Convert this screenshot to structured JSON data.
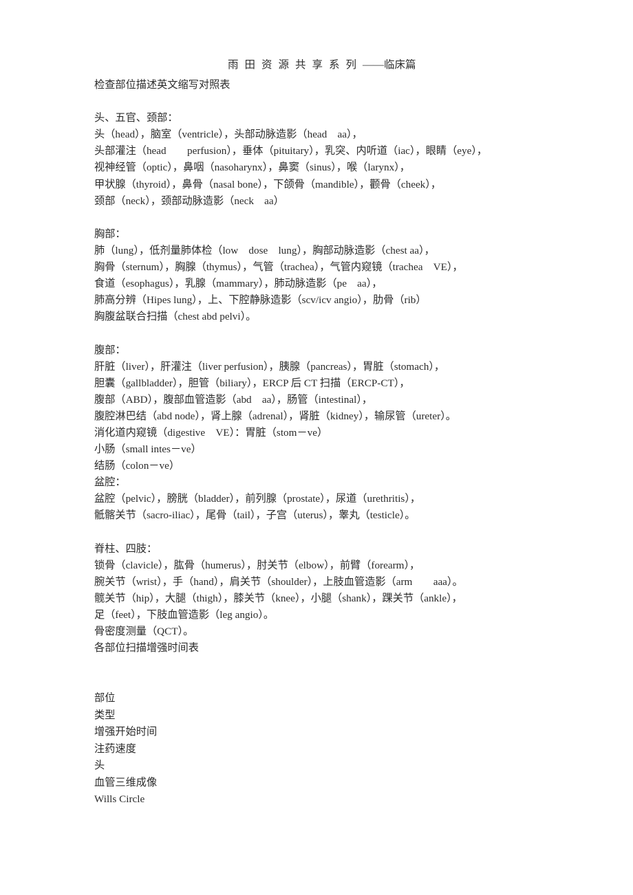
{
  "page": {
    "background_color": "#ffffff",
    "text_color": "#2b2b2b"
  },
  "header": {
    "spaced_text": "雨田资源共享系列",
    "tail_text": "——临床篇"
  },
  "document": {
    "title": "检查部位描述英文缩写对照表",
    "sections": [
      {
        "heading": "头、五官、颈部：",
        "lines": [
          "头（head），脑室（ventricle），头部动脉造影（head　aa），",
          "头部灌注（head　　perfusion），垂体（pituitary），乳突、内听道（iac），眼睛（eye），",
          "视神经管（optic），鼻咽（nasoharynx），鼻窦（sinus），喉（larynx），",
          "甲状腺（thyroid），鼻骨（nasal bone），下颌骨（mandible），颧骨（cheek），",
          "颈部（neck），颈部动脉造影（neck　aa）"
        ]
      },
      {
        "heading": "胸部：",
        "lines": [
          "肺（lung），低剂量肺体检（low　dose　lung），胸部动脉造影（chest aa），",
          "胸骨（sternum），胸腺（thymus），气管（trachea），气管内窥镜（trachea　VE），",
          "食道（esophagus），乳腺（mammary），肺动脉造影（pe　aa），",
          "肺高分辨（Hipes lung），上、下腔静脉造影（scv/icv angio），肋骨（rib）",
          "胸腹盆联合扫描（chest abd pelvi）。"
        ]
      },
      {
        "heading": "腹部：",
        "lines": [
          "肝脏（liver），肝灌注（liver perfusion），胰腺（pancreas），胃脏（stomach），",
          "胆囊（gallbladder），胆管（biliary），ERCP 后 CT 扫描（ERCP-CT），",
          "腹部（ABD），腹部血管造影（abd　aa），肠管（intestinal），",
          "腹腔淋巴结（abd node），肾上腺（adrenal），肾脏（kidney），输尿管（ureter）。",
          "消化道内窥镜（digestive　VE）：胃脏（stom－ve）",
          "小肠（small intes－ve）",
          "结肠（colon－ve）"
        ]
      },
      {
        "heading": "盆腔：",
        "lines": [
          "盆腔（pelvic），膀胱（bladder），前列腺（prostate），尿道（urethritis），",
          "骶髂关节（sacro-iliac），尾骨（tail），子宫（uterus），睾丸（testicle）。"
        ]
      },
      {
        "heading": "脊柱、四肢：",
        "lines": [
          "锁骨（clavicle），肱骨（humerus），肘关节（elbow），前臂（forearm），",
          "腕关节（wrist），手（hand），肩关节（shoulder），上肢血管造影（arm　　aaa）。",
          "髋关节（hip），大腿（thigh），膝关节（knee），小腿（shank），踝关节（ankle），",
          "足（feet），下肢血管造影（leg angio）。",
          "骨密度测量（QCT）。",
          "各部位扫描增强时间表"
        ]
      }
    ],
    "table_fields": [
      "部位",
      "类型",
      "增强开始时间",
      "注药速度",
      "头",
      "血管三维成像",
      "Wills Circle"
    ]
  }
}
